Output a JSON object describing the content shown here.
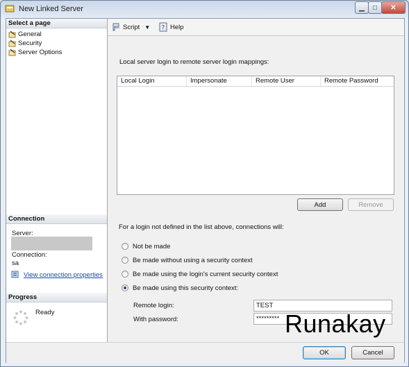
{
  "window": {
    "title": "New Linked Server"
  },
  "left": {
    "select_page_header": "Select a page",
    "pages": [
      {
        "label": "General"
      },
      {
        "label": "Security"
      },
      {
        "label": "Server Options"
      }
    ],
    "connection_header": "Connection",
    "server_label": "Server:",
    "connection_label": "Connection:",
    "connection_value": "sa",
    "view_link": "View connection properties",
    "progress_header": "Progress",
    "progress_status": "Ready"
  },
  "toolbar": {
    "script_label": "Script",
    "help_label": "Help"
  },
  "main": {
    "mappings_label": "Local server login to remote server login mappings:",
    "columns": [
      "Local Login",
      "Impersonate",
      "Remote User",
      "Remote Password"
    ],
    "add_label": "Add",
    "remove_label": "Remove",
    "not_defined_label": "For a login not defined in the list above, connections will:",
    "options": [
      {
        "label": "Not be made",
        "checked": false
      },
      {
        "label": "Be made without using a security context",
        "checked": false
      },
      {
        "label": "Be made using the login's current security context",
        "checked": false
      },
      {
        "label": "Be made using this security context:",
        "checked": true
      }
    ],
    "remote_login_label": "Remote login:",
    "remote_login_value": "TEST",
    "password_label": "With password:",
    "password_value": "*********"
  },
  "footer": {
    "ok_label": "OK",
    "cancel_label": "Cancel"
  },
  "watermark": "Runakay"
}
